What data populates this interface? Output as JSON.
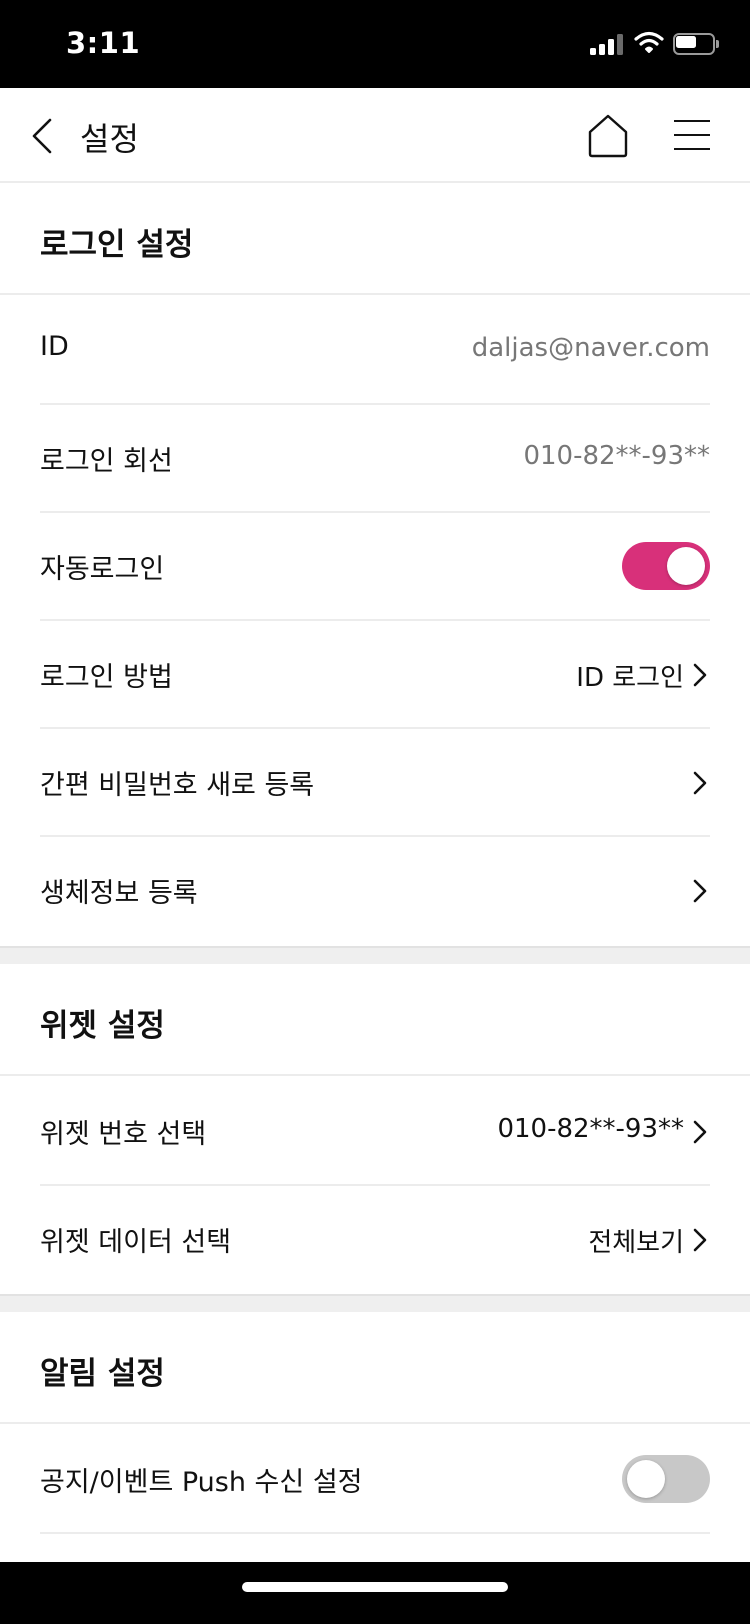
{
  "status_bar": {
    "time": "3:11"
  },
  "header": {
    "title": "설정"
  },
  "login_section": {
    "title": "로그인 설정",
    "rows": [
      {
        "label": "ID",
        "value": "daljas@naver.com"
      },
      {
        "label": "로그인 회선",
        "value": "010-82**-93**"
      },
      {
        "label": "자동로그인",
        "toggle": "on"
      },
      {
        "label": "로그인 방법",
        "value": "ID 로그인"
      },
      {
        "label": "간편 비밀번호 새로 등록"
      },
      {
        "label": "생체정보 등록"
      }
    ]
  },
  "widget_section": {
    "title": "위젯 설정",
    "rows": [
      {
        "label": "위젯 번호 선택",
        "value": "010-82**-93**"
      },
      {
        "label": "위젯 데이터 선택",
        "value": "전체보기"
      }
    ]
  },
  "alarm_section": {
    "title": "알림 설정",
    "rows": [
      {
        "label": "공지/이벤트 Push 수신 설정",
        "toggle": "off"
      }
    ]
  },
  "colors": {
    "accent": "#d8307a",
    "toggle_off": "#c8c8c8",
    "secondary_text": "#777777"
  },
  "icons": [
    "back-arrow-icon",
    "home-icon",
    "hamburger-menu-icon",
    "chevron-right-icon",
    "signal-icon",
    "wifi-icon",
    "battery-icon"
  ]
}
